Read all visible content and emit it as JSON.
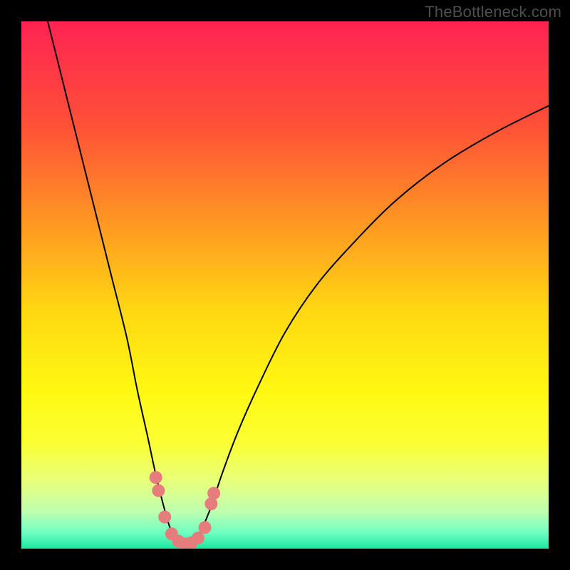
{
  "watermark_text": "TheBottleneck.com",
  "chart_data": {
    "type": "line",
    "title": "",
    "xlabel": "",
    "ylabel": "",
    "xlim": [
      0,
      100
    ],
    "ylim": [
      0,
      100
    ],
    "grid": false,
    "legend": false,
    "background": {
      "type": "vertical-gradient",
      "stops": [
        {
          "offset": 0.0,
          "color": "#ff2353"
        },
        {
          "offset": 0.2,
          "color": "#ff5137"
        },
        {
          "offset": 0.4,
          "color": "#ff9e20"
        },
        {
          "offset": 0.55,
          "color": "#ffd813"
        },
        {
          "offset": 0.7,
          "color": "#fff811"
        },
        {
          "offset": 0.8,
          "color": "#fbff33"
        },
        {
          "offset": 0.87,
          "color": "#e9ff7a"
        },
        {
          "offset": 0.93,
          "color": "#bfffb0"
        },
        {
          "offset": 0.97,
          "color": "#6effc1"
        },
        {
          "offset": 1.0,
          "color": "#1ce7a0"
        }
      ]
    },
    "series": [
      {
        "name": "bottleneck-curve",
        "stroke": "#000000",
        "stroke_width": 2,
        "x": [
          5,
          8,
          11,
          14,
          17,
          20,
          22,
          24,
          25.5,
          27,
          28,
          29,
          30,
          31,
          32,
          33,
          34,
          36,
          38,
          41,
          45,
          50,
          56,
          63,
          71,
          80,
          90,
          100
        ],
        "y": [
          100,
          88,
          76,
          64,
          52,
          40,
          30,
          21,
          14,
          8,
          4.5,
          2.2,
          1.0,
          0.6,
          0.8,
          1.6,
          3.2,
          8,
          14,
          22,
          31,
          41,
          50,
          58,
          66,
          73,
          79,
          84
        ]
      }
    ],
    "markers": [
      {
        "name": "highlight-dots",
        "color": "#e77c7c",
        "radius": 9,
        "points": [
          {
            "x": 25.5,
            "y": 13.5
          },
          {
            "x": 26.0,
            "y": 11.0
          },
          {
            "x": 27.2,
            "y": 6.0
          },
          {
            "x": 28.5,
            "y": 2.8
          },
          {
            "x": 29.8,
            "y": 1.4
          },
          {
            "x": 31.0,
            "y": 0.9
          },
          {
            "x": 32.2,
            "y": 1.1
          },
          {
            "x": 33.5,
            "y": 2.0
          },
          {
            "x": 34.8,
            "y": 4.0
          },
          {
            "x": 36.0,
            "y": 8.5
          },
          {
            "x": 36.5,
            "y": 10.5
          }
        ]
      }
    ]
  }
}
